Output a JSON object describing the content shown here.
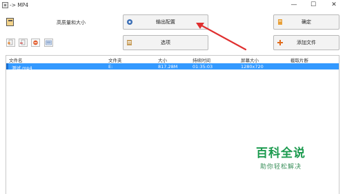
{
  "window": {
    "title": "-> MP4",
    "minimize_glyph": "—",
    "maximize_glyph": "☐",
    "close_glyph": "✕"
  },
  "preset": {
    "label": "高质量和大小"
  },
  "buttons": {
    "output_config": "输出配置",
    "ok": "确定",
    "options": "选项",
    "add_file": "添加文件"
  },
  "toolbar_icons": [
    "add-file-icon",
    "remove-file-icon",
    "clear-icon",
    "media-info-icon"
  ],
  "table": {
    "columns": [
      "文件名",
      "文件夹",
      "大小",
      "持续时间",
      "屏幕大小",
      "截取片断"
    ],
    "rows": [
      {
        "name": "测试.mp4",
        "folder": "E:",
        "size": "817.28M",
        "duration": "01:35:03",
        "screen": "1280x720",
        "clip": ""
      }
    ]
  },
  "watermark": {
    "title": "百科全说",
    "subtitle": "助你轻松解决"
  },
  "colors": {
    "selection": "#3399ff",
    "arrow": "#e03030",
    "watermark": "#1b9a4e"
  }
}
